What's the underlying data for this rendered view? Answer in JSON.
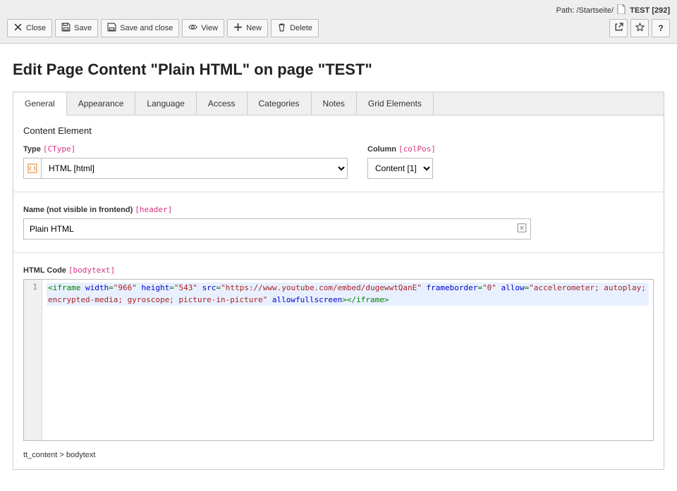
{
  "path": {
    "label": "Path:",
    "root": "/Startseite/",
    "current": "TEST",
    "uid": "[292]"
  },
  "toolbar": {
    "close": "Close",
    "save": "Save",
    "saveclose": "Save and close",
    "view": "View",
    "new": "New",
    "delete": "Delete"
  },
  "page_title": "Edit Page Content \"Plain HTML\" on page \"TEST\"",
  "tabs": [
    "General",
    "Appearance",
    "Language",
    "Access",
    "Categories",
    "Notes",
    "Grid Elements"
  ],
  "general": {
    "section": "Content Element",
    "type": {
      "label": "Type",
      "tech": "[CType]",
      "value": "HTML [html]"
    },
    "column": {
      "label": "Column",
      "tech": "[colPos]",
      "value": "Content [1]"
    },
    "name": {
      "label": "Name (not visible in frontend)",
      "tech": "[header]",
      "value": "Plain HTML"
    },
    "html": {
      "label": "HTML Code",
      "tech": "[bodytext]",
      "tokens": [
        {
          "t": "tag",
          "v": "<iframe"
        },
        {
          "t": "txt",
          "v": " "
        },
        {
          "t": "attr",
          "v": "width"
        },
        {
          "t": "tag",
          "v": "="
        },
        {
          "t": "str",
          "v": "\"966\""
        },
        {
          "t": "txt",
          "v": " "
        },
        {
          "t": "attr",
          "v": "height"
        },
        {
          "t": "tag",
          "v": "="
        },
        {
          "t": "str",
          "v": "\"543\""
        },
        {
          "t": "txt",
          "v": " "
        },
        {
          "t": "attr",
          "v": "src"
        },
        {
          "t": "tag",
          "v": "="
        },
        {
          "t": "str",
          "v": "\"https://www.youtube.com/embed/dugewwtQanE\""
        },
        {
          "t": "txt",
          "v": " "
        },
        {
          "t": "attr",
          "v": "frameborder"
        },
        {
          "t": "tag",
          "v": "="
        },
        {
          "t": "str",
          "v": "\"0\""
        },
        {
          "t": "txt",
          "v": " "
        },
        {
          "t": "attr",
          "v": "allow"
        },
        {
          "t": "tag",
          "v": "="
        },
        {
          "t": "str",
          "v": "\"accelerometer; autoplay; encrypted-media; gyroscope; picture-in-picture\""
        },
        {
          "t": "txt",
          "v": " "
        },
        {
          "t": "attr",
          "v": "allowfullscreen"
        },
        {
          "t": "tag",
          "v": ">"
        },
        {
          "t": "tag",
          "v": "</iframe>"
        }
      ]
    }
  },
  "footer": "tt_content > bodytext"
}
